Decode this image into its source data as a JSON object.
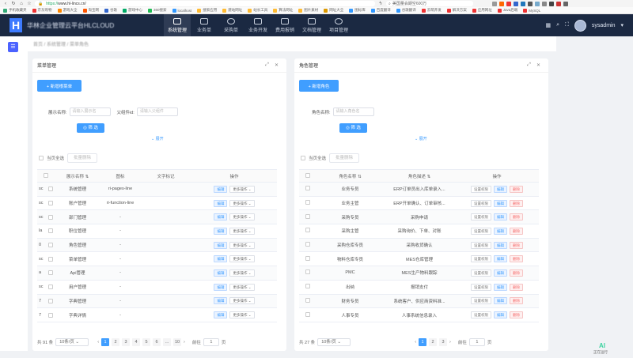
{
  "browser": {
    "url_scheme": "https://",
    "url_host": "www.hl-lincs.cn/",
    "search_text": "美国量会期空600万",
    "bookmarks": [
      "手机收藏夹",
      "京东购物",
      "游戏大全",
      "淘宝网",
      "谷歌",
      "游戏中心",
      "360搜索",
      "localhost",
      "搜索应用",
      "建站网址",
      "站长工具",
      "算法网址",
      "图片素材",
      "网址大全",
      "图标库",
      "百度翻译",
      "谷歌翻译",
      "云萌开发",
      "解决方案",
      "应用网址",
      "Java后端",
      "MySQL"
    ]
  },
  "header": {
    "logo_letter": "H",
    "app_title": "华林企业管理云平台HLCLOUD",
    "nav": [
      {
        "label": "系统管理",
        "icon": "system-icon",
        "active": true
      },
      {
        "label": "业务单",
        "icon": "business-icon",
        "active": false
      },
      {
        "label": "采购单",
        "icon": "purchase-icon",
        "active": false
      },
      {
        "label": "业务开发",
        "icon": "dev-icon",
        "active": false
      },
      {
        "label": "费用报销",
        "icon": "expense-icon",
        "active": false
      },
      {
        "label": "文档管理",
        "icon": "document-icon",
        "active": false
      },
      {
        "label": "项目管理",
        "icon": "project-icon",
        "active": false
      }
    ],
    "user_name": "sysadmin"
  },
  "breadcrumb": "首页 / 系统管理 / 菜单角色",
  "menu_panel": {
    "title": "菜单管理",
    "add_button": "+ 新增根菜单",
    "filter_labels": [
      "展示名称:",
      "父组件id:"
    ],
    "filter_placeholders": [
      "请输入展示名",
      "请输入父组件"
    ],
    "filter_button": "◎ 筛 选",
    "expand_link": "展开",
    "select_all": "当页全选",
    "batch_delete": "批量删除",
    "columns": [
      "",
      "展示名称",
      "图标",
      "文字标记",
      "操作"
    ],
    "rows": [
      {
        "lead": "sc",
        "name": "系统管理",
        "icon": "ri-pages-line",
        "mark": ""
      },
      {
        "lead": "sc",
        "name": "账户管理",
        "icon": "ri-function-line",
        "mark": ""
      },
      {
        "lead": "sc",
        "name": "部门管理",
        "icon": "-",
        "mark": ""
      },
      {
        "lead": "la",
        "name": "职位管理",
        "icon": "-",
        "mark": ""
      },
      {
        "lead": "0",
        "name": "角色管理",
        "icon": "-",
        "mark": ""
      },
      {
        "lead": "sc",
        "name": "菜单管理",
        "icon": "-",
        "mark": ""
      },
      {
        "lead": "a",
        "name": "Api管理",
        "icon": "-",
        "mark": ""
      },
      {
        "lead": "sc",
        "name": "用户管理",
        "icon": "-",
        "mark": ""
      },
      {
        "lead": "7",
        "name": "字典管理",
        "icon": "-",
        "mark": ""
      },
      {
        "lead": "7",
        "name": "字典详情",
        "icon": "-",
        "mark": ""
      }
    ],
    "op_edit": "编辑",
    "op_more": "更多操作 ⌄",
    "total": "共 91 条",
    "page_size": "10条/页",
    "pages": [
      "1",
      "2",
      "3",
      "4",
      "5",
      "6",
      "...",
      "10"
    ],
    "goto_label": "前往",
    "goto_value": "1",
    "goto_unit": "页"
  },
  "role_panel": {
    "title": "角色管理",
    "add_button": "+ 新增角色",
    "filter_label": "角色名称:",
    "filter_placeholder": "请输入角色名",
    "filter_button": "◎ 筛 选",
    "expand_link": "展开",
    "select_all": "当页全选",
    "batch_delete": "批量删除",
    "columns": [
      "",
      "角色名称",
      "角色描述",
      "操作"
    ],
    "rows": [
      {
        "name": "业务专员",
        "desc": "ERP订单员出入库单录入..."
      },
      {
        "name": "业务主管",
        "desc": "ERP开单确认、订单审核..."
      },
      {
        "name": "采购专员",
        "desc": "采购申请"
      },
      {
        "name": "采购主管",
        "desc": "采购询价、下单、对账"
      },
      {
        "name": "采购仓库专员",
        "desc": "采购收货确认"
      },
      {
        "name": "物料仓库专员",
        "desc": "MES仓库管理"
      },
      {
        "name": "PMC",
        "desc": "MES生产物料跟踪"
      },
      {
        "name": "出纳",
        "desc": "报销支付"
      },
      {
        "name": "财务专员",
        "desc": "系统客户、供应商资料准..."
      },
      {
        "name": "人事专员",
        "desc": "人事系统信息录入"
      }
    ],
    "op_perm": "设置权限",
    "op_edit": "编辑",
    "op_delete": "删除",
    "total": "共 27 条",
    "page_size": "10条/页",
    "pages": [
      "1",
      "2",
      "3"
    ],
    "goto_label": "前往",
    "goto_value": "1",
    "goto_unit": "页"
  },
  "ai_badge": "AI",
  "ai_sub": "正在运行"
}
